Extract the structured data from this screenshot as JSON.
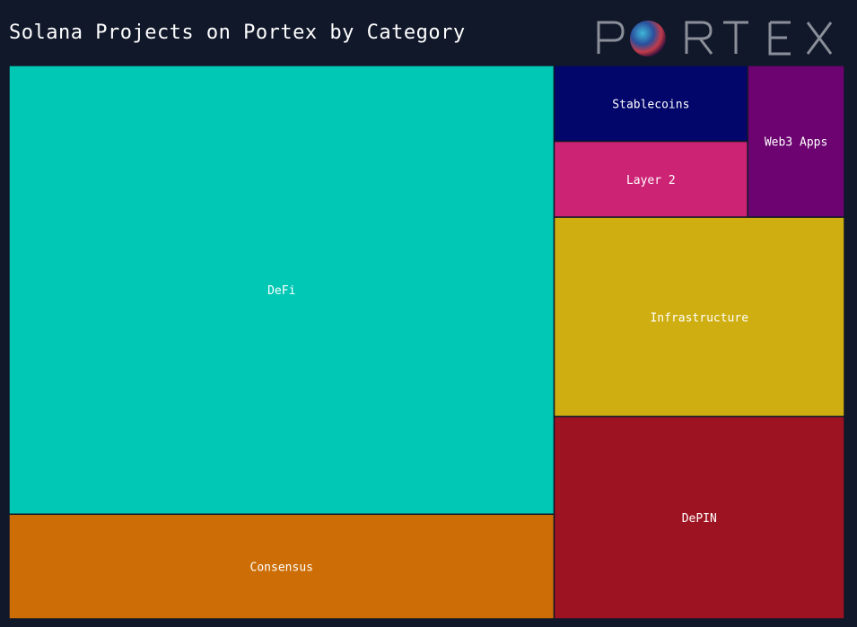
{
  "header": {
    "title": "Solana Projects on Portex by Category",
    "logo_text": "PORTEX"
  },
  "colors": {
    "background": "#11182a",
    "tile_border": "#11182a"
  },
  "chart_data": {
    "type": "treemap",
    "title": "Solana Projects on Portex by Category",
    "items": [
      {
        "label": "DeFi",
        "value": 30.0,
        "color": "#00c8b4"
      },
      {
        "label": "Consensus",
        "value": 7.0,
        "color": "#cc6e05"
      },
      {
        "label": "DePIN",
        "value": 7.2,
        "color": "#9e1322"
      },
      {
        "label": "Infrastructure",
        "value": 7.1,
        "color": "#ceae10"
      },
      {
        "label": "Stablecoins",
        "value": 1.8,
        "color": "#02056a"
      },
      {
        "label": "Layer 2",
        "value": 1.8,
        "color": "#cc2374"
      },
      {
        "label": "Web3 Apps",
        "value": 1.8,
        "color": "#6c0370"
      }
    ]
  }
}
